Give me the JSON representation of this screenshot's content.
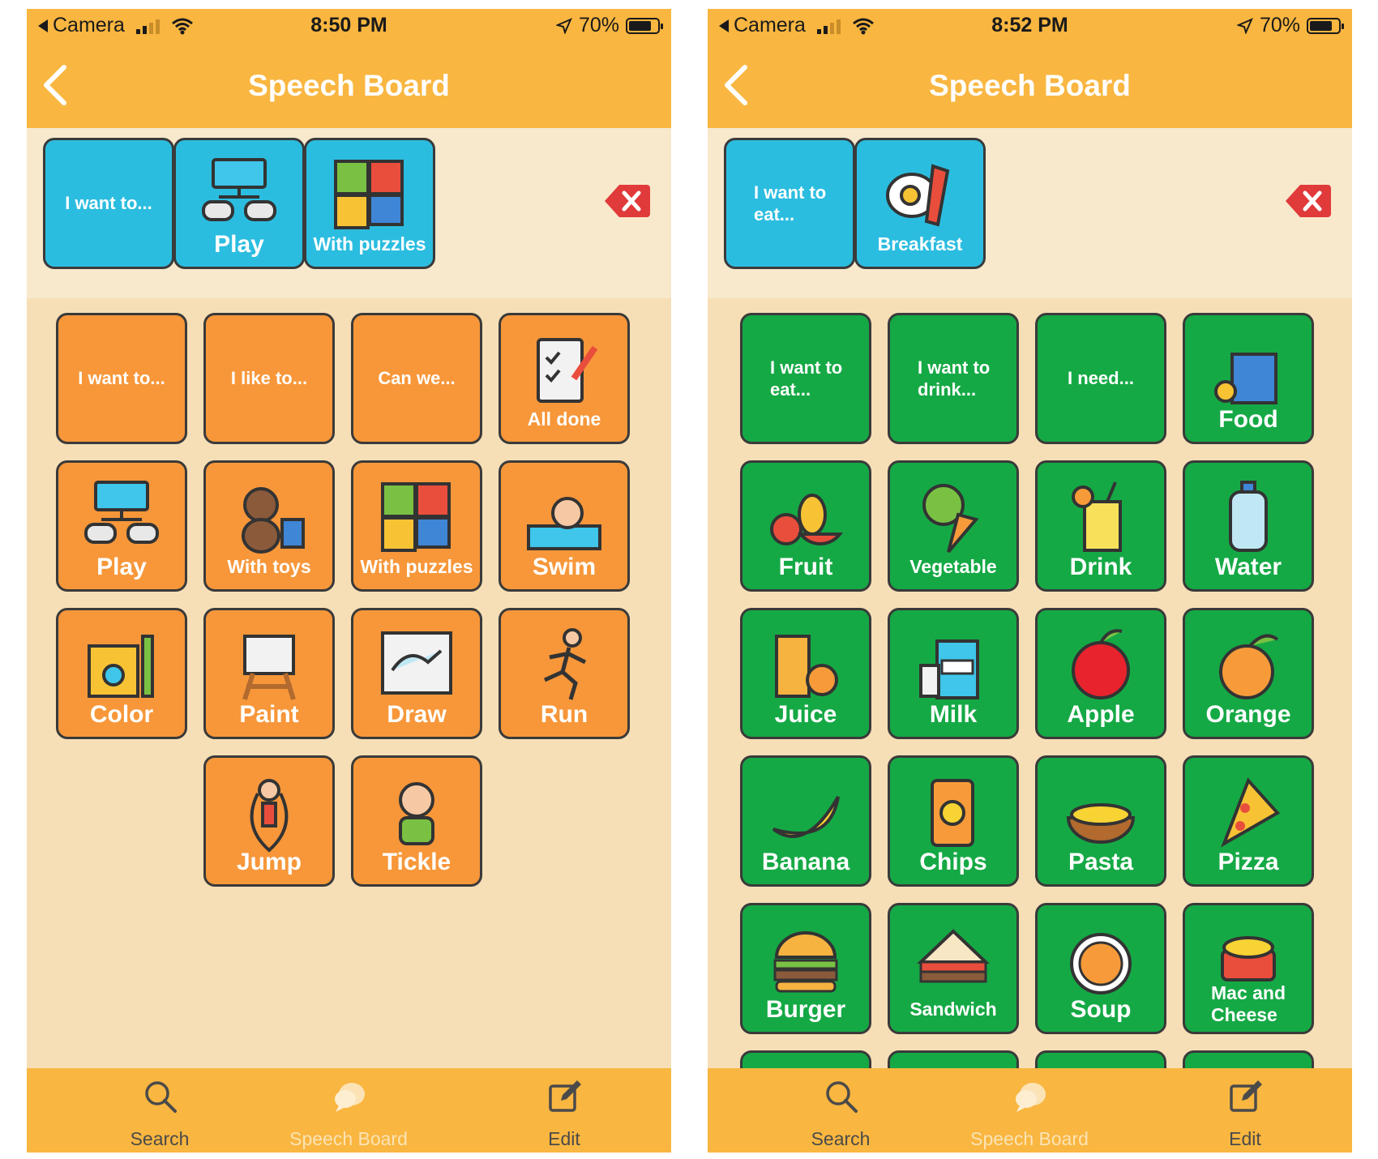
{
  "screens": [
    {
      "status": {
        "app": "Camera",
        "time": "8:50 PM",
        "battery": "70%",
        "battery_level": 0.7
      },
      "nav": {
        "title": "Speech Board"
      },
      "sentence": [
        {
          "label": "I want to...",
          "icon": "none"
        },
        {
          "label": "Play",
          "icon": "game-controllers-icon"
        },
        {
          "label": "With puzzles",
          "icon": "puzzle-icon"
        }
      ],
      "grid": [
        {
          "label": "I want to...",
          "icon": "none"
        },
        {
          "label": "I like to...",
          "icon": "none"
        },
        {
          "label": "Can we...",
          "icon": "none"
        },
        {
          "label": "All done",
          "icon": "checklist-icon"
        },
        {
          "label": "Play",
          "icon": "game-controllers-icon"
        },
        {
          "label": "With toys",
          "icon": "teddy-bear-icon"
        },
        {
          "label": "With puzzles",
          "icon": "puzzle-icon"
        },
        {
          "label": "Swim",
          "icon": "swimmer-icon"
        },
        {
          "label": "Color",
          "icon": "crayons-icon"
        },
        {
          "label": "Paint",
          "icon": "easel-icon"
        },
        {
          "label": "Draw",
          "icon": "sketchbook-icon"
        },
        {
          "label": "Run",
          "icon": "runner-icon"
        },
        {
          "label": "Jump",
          "icon": "jump-rope-icon"
        },
        {
          "label": "Tickle",
          "icon": "laughing-child-icon"
        }
      ],
      "tabs": [
        {
          "label": "Search",
          "icon": "search-icon"
        },
        {
          "label": "Speech Board",
          "icon": "speech-bubble-icon"
        },
        {
          "label": "Edit",
          "icon": "edit-icon"
        }
      ],
      "active_tab": "Speech Board"
    },
    {
      "status": {
        "app": "Camera",
        "time": "8:52 PM",
        "battery": "70%",
        "battery_level": 0.7
      },
      "nav": {
        "title": "Speech Board"
      },
      "sentence": [
        {
          "label": "I want to eat...",
          "icon": "none"
        },
        {
          "label": "Breakfast",
          "icon": "egg-bacon-icon"
        }
      ],
      "grid": [
        {
          "label": "I want to eat...",
          "icon": "none"
        },
        {
          "label": "I want to drink...",
          "icon": "none"
        },
        {
          "label": "I need...",
          "icon": "none"
        },
        {
          "label": "Food",
          "icon": "groceries-icon"
        },
        {
          "label": "Fruit",
          "icon": "fruit-basket-icon"
        },
        {
          "label": "Vegetable",
          "icon": "vegetables-icon"
        },
        {
          "label": "Drink",
          "icon": "cup-straw-icon"
        },
        {
          "label": "Water",
          "icon": "water-bottle-icon"
        },
        {
          "label": "Juice",
          "icon": "juice-glass-icon"
        },
        {
          "label": "Milk",
          "icon": "milk-carton-icon"
        },
        {
          "label": "Apple",
          "icon": "apple-icon"
        },
        {
          "label": "Orange",
          "icon": "orange-icon"
        },
        {
          "label": "Banana",
          "icon": "banana-icon"
        },
        {
          "label": "Chips",
          "icon": "chips-bag-icon"
        },
        {
          "label": "Pasta",
          "icon": "pasta-bowl-icon"
        },
        {
          "label": "Pizza",
          "icon": "pizza-slice-icon"
        },
        {
          "label": "Burger",
          "icon": "burger-icon"
        },
        {
          "label": "Sandwich",
          "icon": "sandwich-icon"
        },
        {
          "label": "Soup",
          "icon": "soup-bowl-icon"
        },
        {
          "label": "Mac and Cheese",
          "icon": "mac-cheese-icon"
        }
      ],
      "tabs": [
        {
          "label": "Search",
          "icon": "search-icon"
        },
        {
          "label": "Speech Board",
          "icon": "speech-bubble-icon"
        },
        {
          "label": "Edit",
          "icon": "edit-icon"
        }
      ],
      "active_tab": "Speech Board"
    }
  ],
  "colors": {
    "header": "#f9b640",
    "background": "#f6dfb6",
    "sentence_bar": "#f8e8cc",
    "tile_blue": "#2bbde0",
    "tile_orange": "#f7973a",
    "tile_green": "#15a945",
    "delete_red": "#e03a3a",
    "tile_border": "#3a3a3a"
  }
}
